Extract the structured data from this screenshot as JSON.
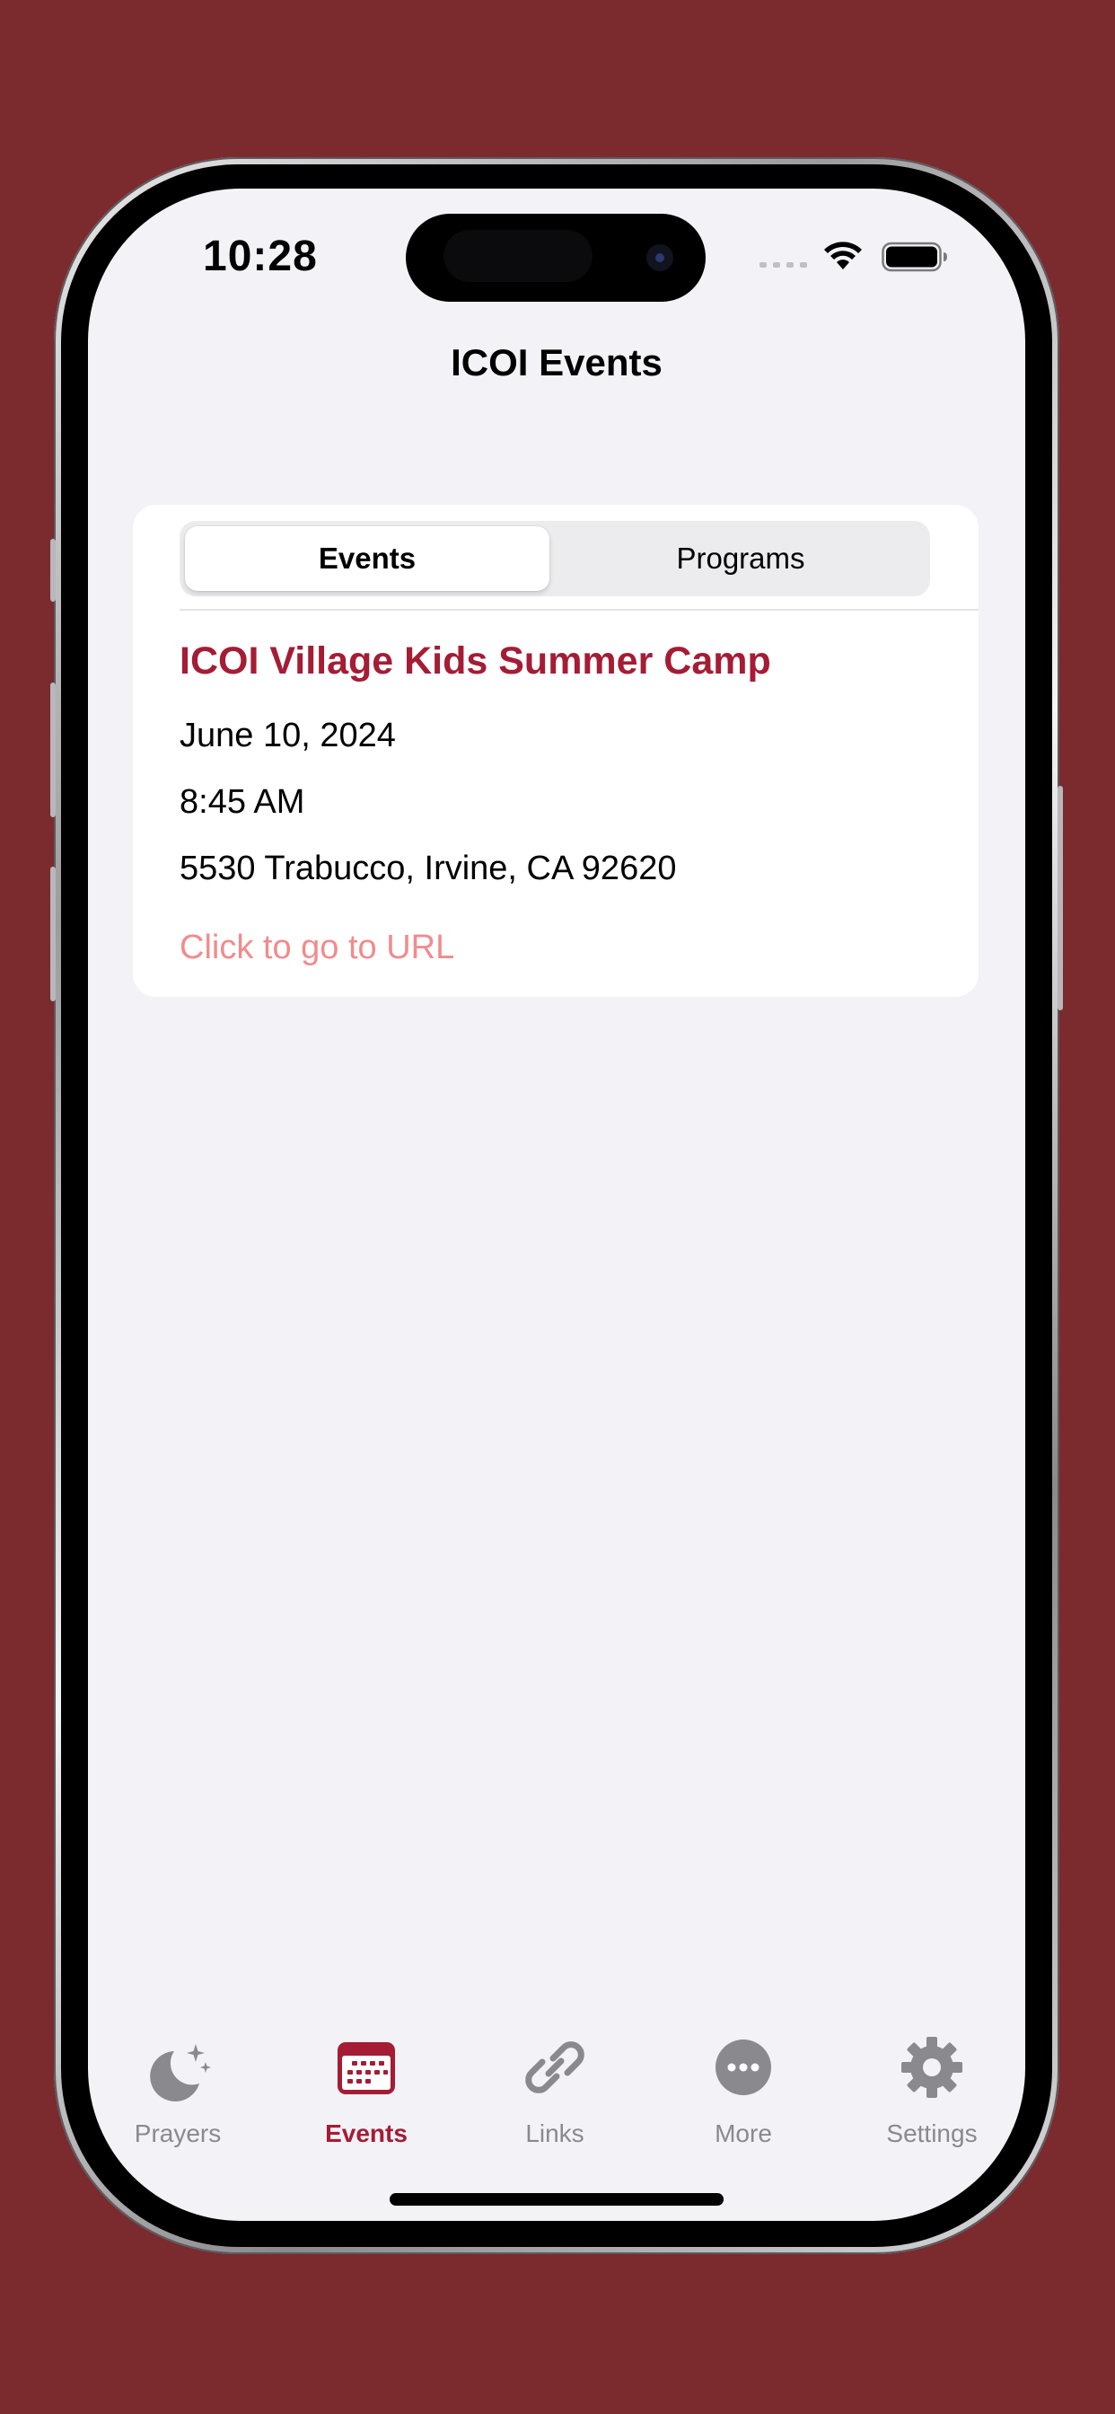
{
  "status_bar": {
    "time": "10:28"
  },
  "nav": {
    "title": "ICOI Events"
  },
  "segmented_control": {
    "options": [
      {
        "label": "Events",
        "selected": true
      },
      {
        "label": "Programs",
        "selected": false
      }
    ]
  },
  "event": {
    "title": "ICOI Village Kids Summer Camp",
    "date": "June 10, 2024",
    "time": "8:45 AM",
    "address": "5530 Trabucco, Irvine, CA 92620",
    "link_text": "Click to go to URL"
  },
  "tab_bar": {
    "items": [
      {
        "label": "Prayers",
        "icon": "moon-stars-icon",
        "selected": false
      },
      {
        "label": "Events",
        "icon": "calendar-icon",
        "selected": true
      },
      {
        "label": "Links",
        "icon": "link-icon",
        "selected": false
      },
      {
        "label": "More",
        "icon": "ellipsis-circle-icon",
        "selected": false
      },
      {
        "label": "Settings",
        "icon": "gear-icon",
        "selected": false
      }
    ]
  },
  "colors": {
    "background": "#7b2a2e",
    "accent": "#a51c35",
    "link": "#f18b8d",
    "tab_inactive": "#8a8a8e",
    "screen_background": "#f2f2f7"
  }
}
